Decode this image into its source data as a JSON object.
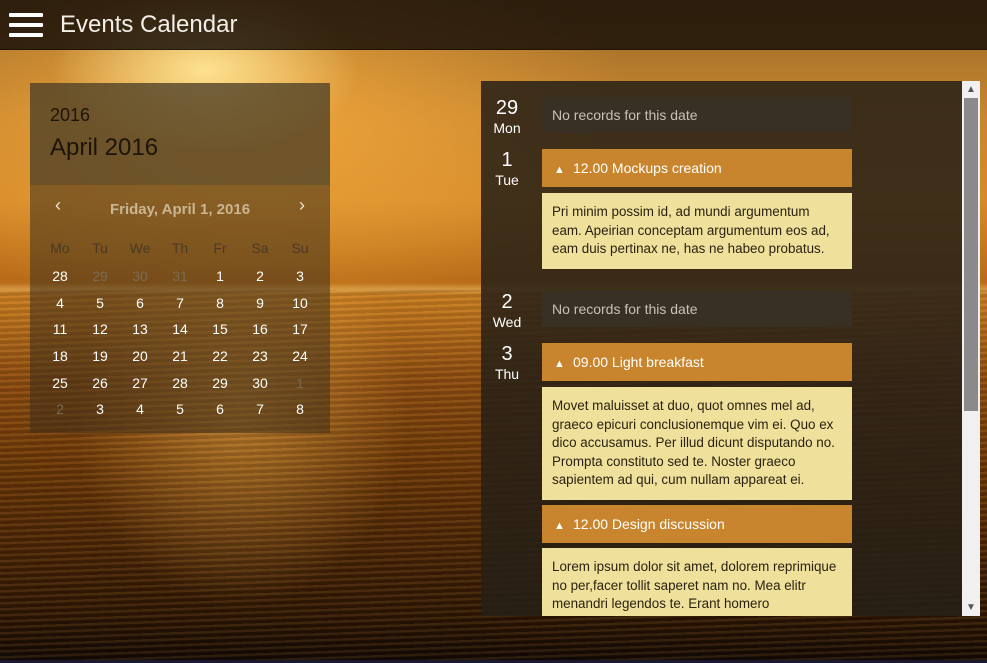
{
  "app": {
    "title": "Events Calendar"
  },
  "calendar": {
    "year": "2016",
    "month_title": "April 2016",
    "selected_date": "Friday, April 1, 2016",
    "prev_label": "‹",
    "next_label": "›",
    "weekdays": [
      "Mo",
      "Tu",
      "We",
      "Th",
      "Fr",
      "Sa",
      "Su"
    ],
    "weeks": [
      [
        {
          "d": "28",
          "m": false
        },
        {
          "d": "29",
          "m": true
        },
        {
          "d": "30",
          "m": true
        },
        {
          "d": "31",
          "m": true
        },
        {
          "d": "1",
          "m": false
        },
        {
          "d": "2",
          "m": false
        },
        {
          "d": "3",
          "m": false
        }
      ],
      [
        {
          "d": "4",
          "m": false
        },
        {
          "d": "5",
          "m": false
        },
        {
          "d": "6",
          "m": false
        },
        {
          "d": "7",
          "m": false
        },
        {
          "d": "8",
          "m": false
        },
        {
          "d": "9",
          "m": false
        },
        {
          "d": "10",
          "m": false
        }
      ],
      [
        {
          "d": "11",
          "m": false
        },
        {
          "d": "12",
          "m": false
        },
        {
          "d": "13",
          "m": false
        },
        {
          "d": "14",
          "m": false
        },
        {
          "d": "15",
          "m": false
        },
        {
          "d": "16",
          "m": false
        },
        {
          "d": "17",
          "m": false
        }
      ],
      [
        {
          "d": "18",
          "m": false
        },
        {
          "d": "19",
          "m": false
        },
        {
          "d": "20",
          "m": false
        },
        {
          "d": "21",
          "m": false
        },
        {
          "d": "22",
          "m": false
        },
        {
          "d": "23",
          "m": false
        },
        {
          "d": "24",
          "m": false
        }
      ],
      [
        {
          "d": "25",
          "m": false
        },
        {
          "d": "26",
          "m": false
        },
        {
          "d": "27",
          "m": false
        },
        {
          "d": "28",
          "m": false
        },
        {
          "d": "29",
          "m": false
        },
        {
          "d": "30",
          "m": false
        },
        {
          "d": "1",
          "m": true
        }
      ],
      [
        {
          "d": "2",
          "m": true
        },
        {
          "d": "3",
          "m": false
        },
        {
          "d": "4",
          "m": false
        },
        {
          "d": "5",
          "m": false
        },
        {
          "d": "6",
          "m": false
        },
        {
          "d": "7",
          "m": false
        },
        {
          "d": "8",
          "m": false
        }
      ]
    ]
  },
  "events": {
    "days": [
      {
        "num": "29",
        "dow": "Mon",
        "empty_text": "No records for this date"
      },
      {
        "num": "1",
        "dow": "Tue",
        "items": [
          {
            "time_title": "12.00 Mockups creation",
            "body": "Pri minim possim id, ad mundi argumentum eam. Apeirian conceptam argumentum eos ad, eam duis pertinax ne, has ne habeo probatus."
          }
        ]
      },
      {
        "num": "2",
        "dow": "Wed",
        "empty_text": "No records for this date"
      },
      {
        "num": "3",
        "dow": "Thu",
        "items": [
          {
            "time_title": "09.00 Light breakfast",
            "body": "Movet maluisset at duo, quot omnes mel ad, graeco epicuri conclusionemque vim ei. Quo ex dico accusamus. Per illud dicunt disputando no. Prompta constituto sed te. Noster graeco sapientem ad qui, cum nullam appareat ei."
          },
          {
            "time_title": "12.00 Design discussion",
            "body": "Lorem ipsum dolor sit amet, dolorem reprimique no per,facer tollit saperet nam no. Mea elitr menandri legendos te. Erant homero"
          }
        ]
      }
    ]
  },
  "colors": {
    "event_header": "#c9852d",
    "event_body": "#efe19c",
    "panel_dark": "#26201a"
  },
  "icons": {
    "menu": "hamburger-icon",
    "collapse": "chevron-up-icon"
  }
}
